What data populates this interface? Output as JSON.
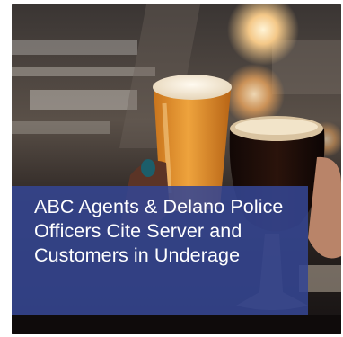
{
  "article": {
    "image_alt": "Two people toasting glasses of beer at a bar",
    "headline": "ABC Agents & Delano Police Officers Cite Server and Customers in Underage"
  },
  "colors": {
    "caption_background": "#344592",
    "caption_text": "#ffffff"
  }
}
